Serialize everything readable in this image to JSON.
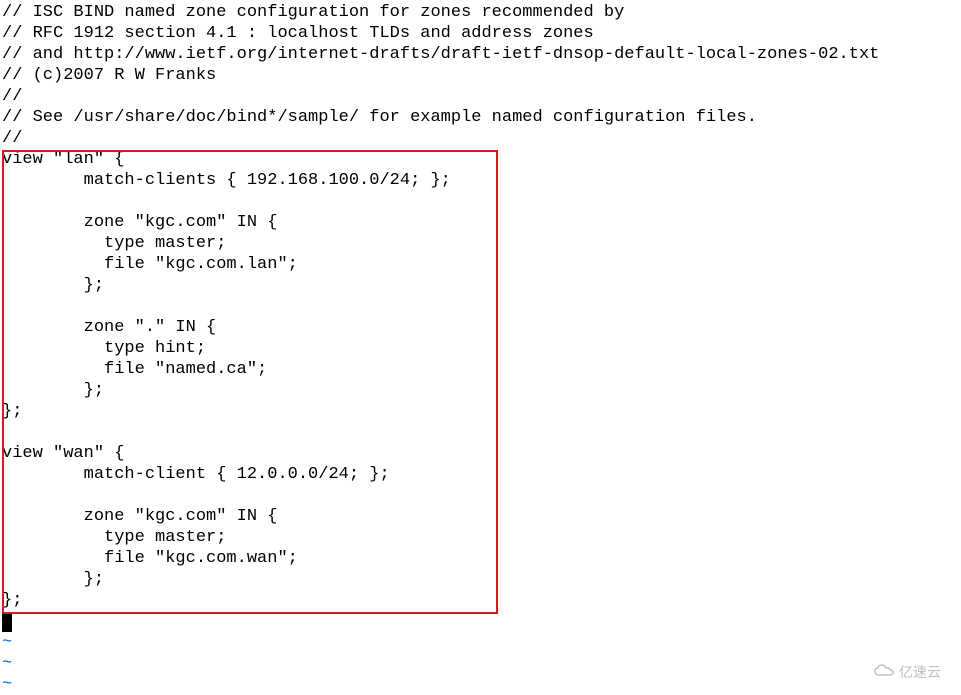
{
  "comments": {
    "line1": "// ISC BIND named zone configuration for zones recommended by",
    "line2": "// RFC 1912 section 4.1 : localhost TLDs and address zones",
    "line3": "// and http://www.ietf.org/internet-drafts/draft-ietf-dnsop-default-local-zones-02.txt",
    "line4": "// (c)2007 R W Franks",
    "line5": "//",
    "line6": "// See /usr/share/doc/bind*/sample/ for example named configuration files.",
    "line7": "//"
  },
  "config": {
    "line01": "view \"lan\" {",
    "line02": "        match-clients { 192.168.100.0/24; };",
    "line03": "",
    "line04": "        zone \"kgc.com\" IN {",
    "line05": "          type master;",
    "line06": "          file \"kgc.com.lan\";",
    "line07": "        };",
    "line08": "",
    "line09": "        zone \".\" IN {",
    "line10": "          type hint;",
    "line11": "          file \"named.ca\";",
    "line12": "        };",
    "line13": "};",
    "line14": "",
    "line15": "view \"wan\" {",
    "line16": "        match-client { 12.0.0.0/24; };",
    "line17": "",
    "line18": "        zone \"kgc.com\" IN {",
    "line19": "          type master;",
    "line20": "          file \"kgc.com.wan\";",
    "line21": "        };",
    "line22": "};"
  },
  "tilde": "~",
  "watermark": {
    "text": "亿速云"
  }
}
